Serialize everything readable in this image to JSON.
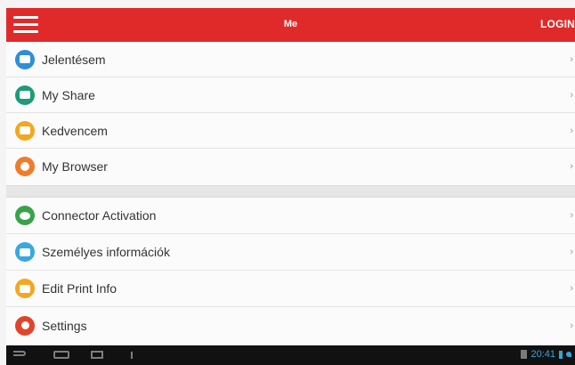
{
  "app_bar": {
    "title": "Me",
    "login_label": "LOGIN",
    "menu_icon": "hamburger-menu-icon",
    "color": "#e02a2a"
  },
  "menu_groups": [
    {
      "items": [
        {
          "label": "Jelentésem",
          "icon": "report-icon",
          "color": "#2e8fd6"
        },
        {
          "label": "My Share",
          "icon": "share-icon",
          "color": "#1e9a78"
        },
        {
          "label": "Kedvencem",
          "icon": "favorite-icon",
          "color": "#f2a81e"
        },
        {
          "label": "My Browser",
          "icon": "browser-icon",
          "color": "#f07b2a"
        }
      ]
    },
    {
      "items": [
        {
          "label": "Connector Activation",
          "icon": "connector-icon",
          "color": "#3aa24a"
        },
        {
          "label": "Személyes információk",
          "icon": "personal-info-icon",
          "color": "#3aa8e0"
        },
        {
          "label": "Edit Print Info",
          "icon": "print-icon",
          "color": "#f2a81e"
        },
        {
          "label": "Settings",
          "icon": "settings-icon",
          "color": "#e0452a"
        }
      ]
    }
  ],
  "system_bar": {
    "time": "20:41",
    "time_color": "#3aa2d8"
  }
}
